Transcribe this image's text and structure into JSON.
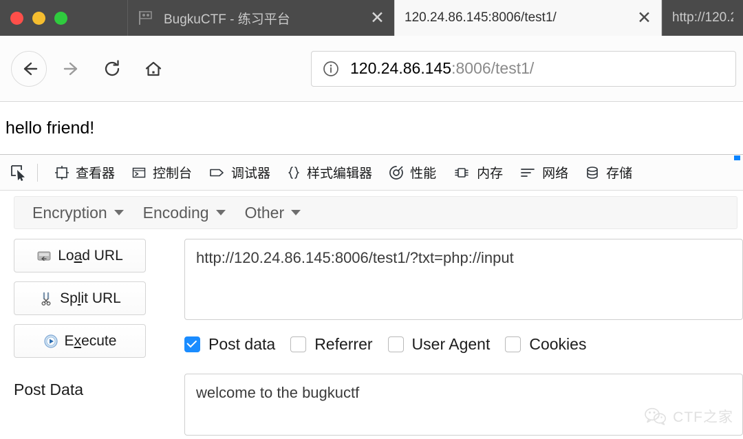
{
  "window": {
    "traffic_lights": [
      "close",
      "minimize",
      "zoom"
    ],
    "colors": {
      "close": "#ff4f4a",
      "minimize": "#f5bd2f",
      "zoom": "#2fcb3e",
      "tabbar_bg": "#4a4a4a",
      "accent_blue": "#1a8cff"
    }
  },
  "tabs": [
    {
      "title": "BugkuCTF - 练习平台",
      "favicon": "flag-icon",
      "active": false,
      "close_label": "✕"
    },
    {
      "title": "120.24.86.145:8006/test1/",
      "favicon": "",
      "active": true,
      "close_label": "✕"
    },
    {
      "title": "http://120.2",
      "favicon": "",
      "active": false,
      "close_label": ""
    }
  ],
  "navbar": {
    "back_label": "back-arrow",
    "forward_label": "forward-arrow",
    "reload_label": "reload",
    "home_label": "home",
    "url_identity_icon": "info-circle-icon",
    "url_host": "120.24.86.145",
    "url_path": ":8006/test1/",
    "url_full": "120.24.86.145:8006/test1/"
  },
  "page": {
    "content": "hello friend!"
  },
  "devtools": {
    "picker_icon": "element-picker-icon",
    "tabs": [
      {
        "label": "查看器",
        "icon": "inspector-icon"
      },
      {
        "label": "控制台",
        "icon": "console-icon"
      },
      {
        "label": "调试器",
        "icon": "debugger-icon"
      },
      {
        "label": "样式编辑器",
        "icon": "style-editor-icon"
      },
      {
        "label": "性能",
        "icon": "performance-icon"
      },
      {
        "label": "内存",
        "icon": "memory-icon"
      },
      {
        "label": "网络",
        "icon": "network-icon"
      },
      {
        "label": "存储",
        "icon": "storage-icon"
      }
    ]
  },
  "hackbar": {
    "menus": [
      {
        "label": "Encryption"
      },
      {
        "label": "Encoding"
      },
      {
        "label": "Other"
      }
    ],
    "buttons": [
      {
        "label_pre": "Lo",
        "label_accel": "a",
        "label_post": "d URL",
        "icon": "load-url-icon"
      },
      {
        "label_pre": "Sp",
        "label_accel": "l",
        "label_post": "it URL",
        "icon": "split-url-icon"
      },
      {
        "label_pre": "E",
        "label_accel": "x",
        "label_post": "ecute",
        "icon": "execute-icon"
      }
    ],
    "url_value": "http://120.24.86.145:8006/test1/?txt=php://input",
    "url_placeholder": "",
    "checkboxes": [
      {
        "label": "Post data",
        "checked": true
      },
      {
        "label": "Referrer",
        "checked": false
      },
      {
        "label": "User Agent",
        "checked": false
      },
      {
        "label": "Cookies",
        "checked": false
      }
    ],
    "post_data_label": "Post Data",
    "post_data_value": "welcome to the bugkuctf",
    "post_data_placeholder": ""
  },
  "watermark": {
    "text": "CTF之家",
    "icon": "wechat-icon"
  }
}
